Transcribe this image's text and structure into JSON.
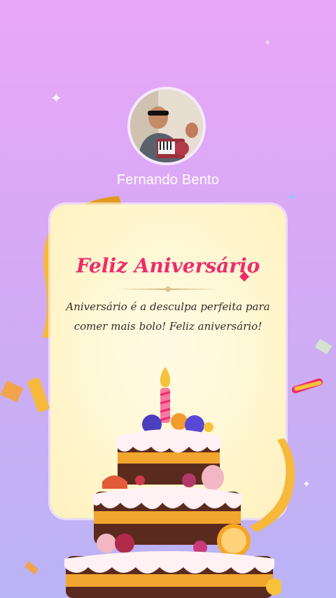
{
  "profile": {
    "name": "Fernando Bento"
  },
  "card": {
    "title": "Feliz Aniversário",
    "message_line1": "Aniversário é a desculpa perfeita para",
    "message_line2": "comer mais bolo! Feliz aniversário!"
  },
  "icons": {
    "avatar": "profile-photo",
    "cake": "birthday-cake-illustration",
    "ribbon": "gold-ribbon",
    "sparkle": "sparkle-star"
  },
  "colors": {
    "background_top": "#e9a8f7",
    "background_bottom": "#b9b4f6",
    "title": "#ef2b6c",
    "card": "#fff6cd"
  }
}
